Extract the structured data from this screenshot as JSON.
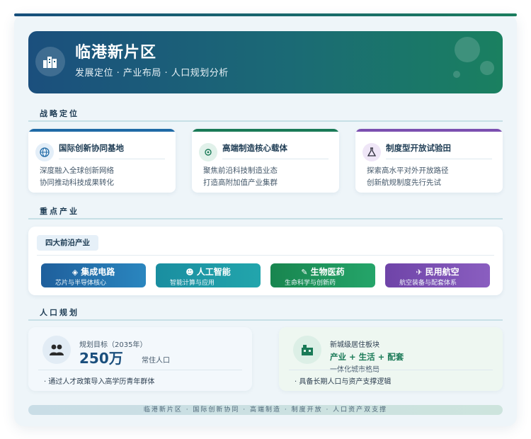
{
  "header": {
    "title": "临港新片区",
    "subtitle": "发展定位 · 产业布局 · 人口规划分析"
  },
  "sections": {
    "strategy": "战略定位",
    "industry": "重点产业",
    "population": "人口规划"
  },
  "strategy_cards": [
    {
      "title": "国际创新协同基地",
      "line1": "深度融入全球创新网络",
      "line2": "协同推动科技成果转化",
      "color": "#1f6aa6",
      "icon": "globe-icon"
    },
    {
      "title": "高端制造核心载体",
      "line1": "聚焦前沿科技制造业态",
      "line2": "打造高附加值产业集群",
      "color": "#1a7a57",
      "icon": "gear-icon"
    },
    {
      "title": "制度型开放试验田",
      "line1": "探索高水平对外开放路径",
      "line2": "创新航规制度先行先试",
      "color": "#7b4fb0",
      "icon": "lab-icon"
    }
  ],
  "industry": {
    "tag": "四大前沿产业",
    "items": [
      {
        "name": "集成电路",
        "desc": "芯片与半导体核心",
        "icon": "chip-icon",
        "color": "#1e6ea8"
      },
      {
        "name": "人工智能",
        "desc": "智能计算与应用",
        "icon": "robot-icon",
        "color": "#1b96a3"
      },
      {
        "name": "生物医药",
        "desc": "生命科学与创新药",
        "icon": "pill-icon",
        "color": "#1a8f5c"
      },
      {
        "name": "民用航空",
        "desc": "航空装备与配套体系",
        "icon": "plane-icon",
        "color": "#7b4fb0"
      }
    ]
  },
  "population": {
    "target_label": "规划目标（2035年）",
    "target_value": "250万",
    "target_unit": "常住人口",
    "target_note": "通过人才政策导入高学历青年群体",
    "block_label": "新城级居住板块",
    "block_formula": "产业 + 生活 + 配套",
    "block_sub": "一体化城市格局",
    "block_note": "具备长期人口与资产支撑逻辑"
  },
  "footer": "临港新片区 · 国际创新协同 · 高端制造 · 制度开放 · 人口资产双支撑"
}
